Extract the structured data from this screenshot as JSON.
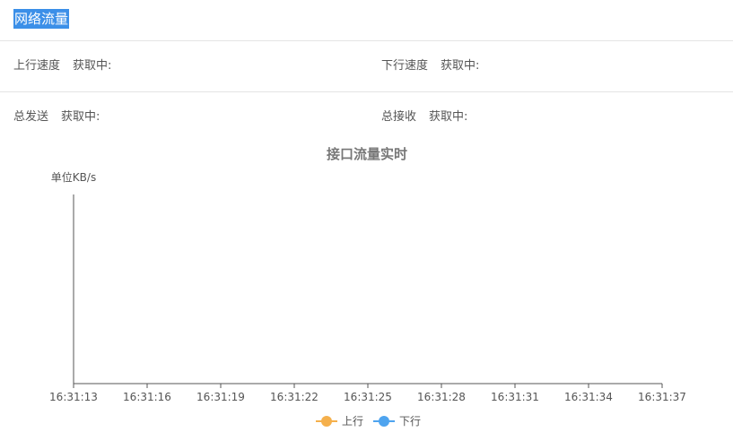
{
  "header": {
    "title": "网络流量"
  },
  "stats": {
    "upload_speed": {
      "label": "上行速度",
      "value": "获取中:"
    },
    "download_speed": {
      "label": "下行速度",
      "value": "获取中:"
    },
    "total_sent": {
      "label": "总发送",
      "value": "获取中:"
    },
    "total_received": {
      "label": "总接收",
      "value": "获取中:"
    }
  },
  "chart_data": {
    "type": "line",
    "title": "接口流量实时",
    "ylabel": "单位KB/s",
    "xlabel": "",
    "categories": [
      "16:31:13",
      "16:31:16",
      "16:31:19",
      "16:31:22",
      "16:31:25",
      "16:31:28",
      "16:31:31",
      "16:31:34",
      "16:31:37"
    ],
    "series": [
      {
        "name": "上行",
        "color": "#f5b04c",
        "values": []
      },
      {
        "name": "下行",
        "color": "#4ea4ef",
        "values": []
      }
    ],
    "grid": false,
    "legend": "bottom-center"
  }
}
